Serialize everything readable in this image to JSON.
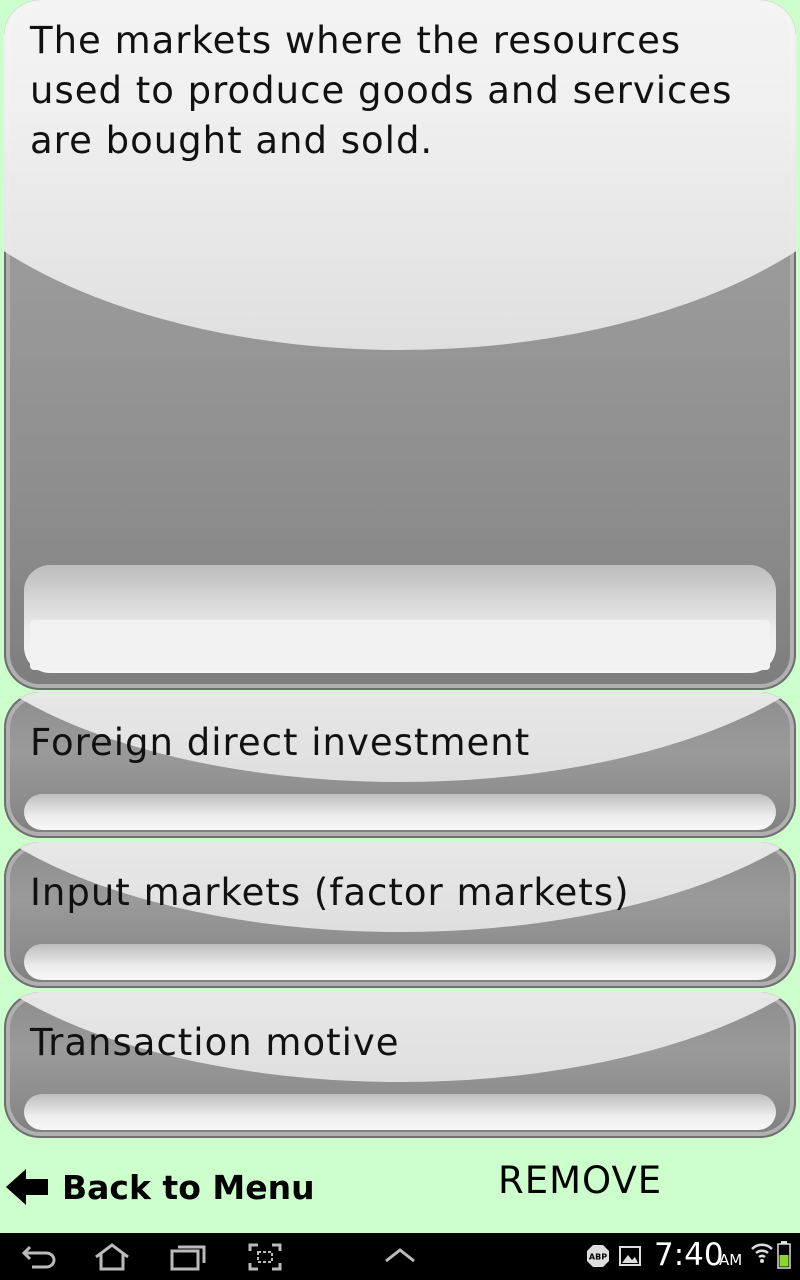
{
  "question": {
    "text": "The markets where the resources used to produce goods and services are bought and sold."
  },
  "answers": [
    {
      "label": "Foreign direct investment"
    },
    {
      "label": "Input markets (factor markets)"
    },
    {
      "label": "Transaction motive"
    }
  ],
  "footer": {
    "back_label": "Back to Menu",
    "remove_label": "REMOVE"
  },
  "status_bar": {
    "time": "7:40",
    "ampm": "AM",
    "adblock_badge": "ABP",
    "battery_color": "#8bd52f"
  },
  "icons": {
    "back": "back-arrow-icon",
    "nav_back": "nav-back-icon",
    "nav_home": "nav-home-icon",
    "nav_recent": "nav-recent-apps-icon",
    "nav_screenshot": "nav-screenshot-icon",
    "nav_up": "nav-chevron-up-icon",
    "gallery": "image-icon",
    "wifi": "wifi-icon",
    "battery": "battery-icon"
  },
  "colors": {
    "background": "#ccffcc",
    "card": "#9a9a9a"
  }
}
